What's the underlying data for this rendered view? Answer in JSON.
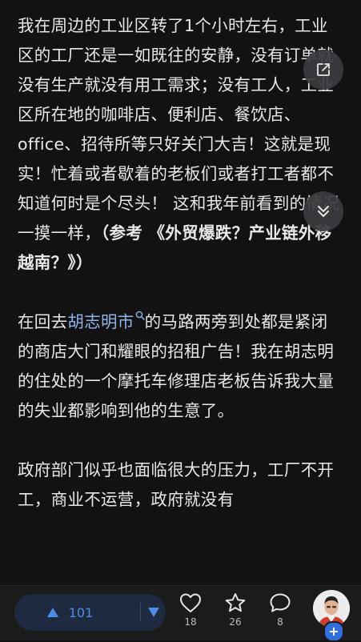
{
  "article": {
    "p1_text": "我在周边的工业区转了1个小时左右，工业区的工厂还是一如既往的安静，没有订单就没有生产就没有用工需求；没有工人，工业区所在地的咖啡店、便利店、餐饮店、office、招待所等只好关门大吉！这就是现实！忙着或者歇着的老板们或者打工者都不知道何时是个尽头！ 这和我年前看到的情况一摸一样，",
    "p1_bold": "（参考 《外贸爆跌？产业链外移越南？》）",
    "p2_before": "在回去",
    "p2_link": "胡志明市",
    "p2_after": "的马路两旁到处都是紧闭的商店大门和耀眼的招租广告！我在胡志明的住处的一个摩托车修理店老板告诉我大量的失业都影响到他的生意了。",
    "p3_text": "政府部门似乎也面临很大的压力，工厂不开工，商业不运营，政府就没有"
  },
  "toolbar": {
    "upvote_count": "101",
    "like_count": "18",
    "favorite_count": "26",
    "comment_count": "8",
    "plus_label": "+"
  },
  "colors": {
    "background": "#121212",
    "text": "#e8e8e8",
    "link": "#8fb4e8",
    "accent": "#4f8be8",
    "vote_pill": "#1e2a40"
  },
  "icons": {
    "share": "share-out-icon",
    "scroll_down": "double-chevron-down-icon",
    "like": "heart-icon",
    "favorite": "star-icon",
    "comment": "comment-bubble-icon",
    "upvote": "triangle-up-icon",
    "downvote": "triangle-down-icon"
  }
}
